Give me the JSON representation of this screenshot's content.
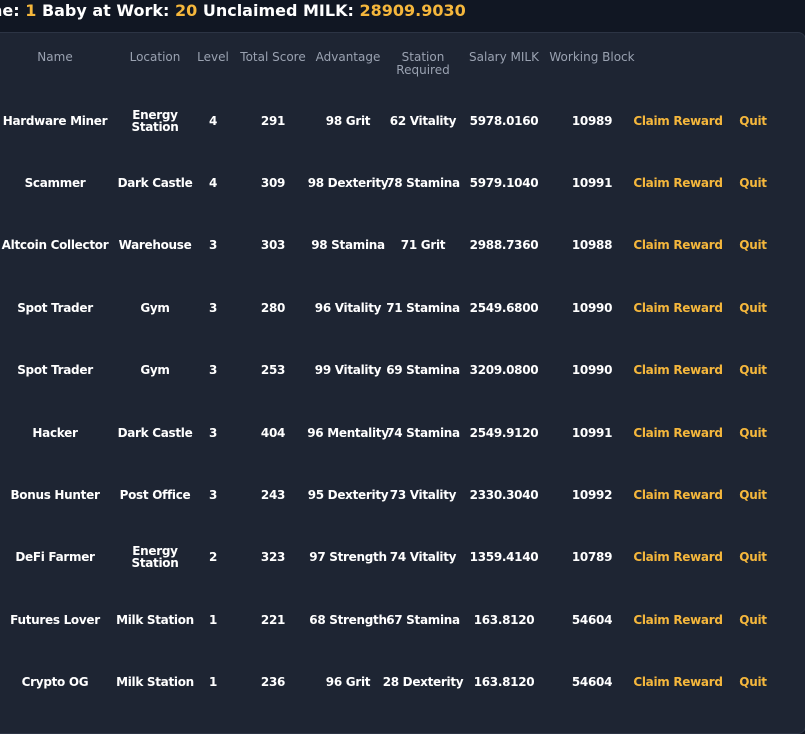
{
  "topbar": {
    "zone_label": "ne:",
    "zone_value": "1",
    "baby_label": "Baby at Work:",
    "baby_value": "20",
    "milk_label": "Unclaimed MILK:",
    "milk_value": "28909.9030"
  },
  "table": {
    "headers": {
      "name": "Name",
      "location": "Location",
      "level": "Level",
      "total_score": "Total Score",
      "advantage": "Advantage",
      "station_required_1": "Station",
      "station_required_2": "Required",
      "salary": "Salary MILK",
      "working_block": "Working Block"
    },
    "action_claim": "Claim Reward",
    "action_quit": "Quit",
    "rows": [
      {
        "name": "Hardware Miner",
        "location": "Energy Station",
        "level": "4",
        "score": "291",
        "advantage": "98 Grit",
        "station": "62 Vitality",
        "salary": "5978.0160",
        "block": "10989"
      },
      {
        "name": "Scammer",
        "location": "Dark Castle",
        "level": "4",
        "score": "309",
        "advantage": "98 Dexterity",
        "station": "78 Stamina",
        "salary": "5979.1040",
        "block": "10991"
      },
      {
        "name": "Altcoin Collector",
        "location": "Warehouse",
        "level": "3",
        "score": "303",
        "advantage": "98 Stamina",
        "station": "71 Grit",
        "salary": "2988.7360",
        "block": "10988"
      },
      {
        "name": "Spot Trader",
        "location": "Gym",
        "level": "3",
        "score": "280",
        "advantage": "96 Vitality",
        "station": "71 Stamina",
        "salary": "2549.6800",
        "block": "10990"
      },
      {
        "name": "Spot Trader",
        "location": "Gym",
        "level": "3",
        "score": "253",
        "advantage": "99 Vitality",
        "station": "69 Stamina",
        "salary": "3209.0800",
        "block": "10990"
      },
      {
        "name": "Hacker",
        "location": "Dark Castle",
        "level": "3",
        "score": "404",
        "advantage": "96 Mentality",
        "station": "74 Stamina",
        "salary": "2549.9120",
        "block": "10991"
      },
      {
        "name": "Bonus Hunter",
        "location": "Post Office",
        "level": "3",
        "score": "243",
        "advantage": "95 Dexterity",
        "station": "73 Vitality",
        "salary": "2330.3040",
        "block": "10992"
      },
      {
        "name": "DeFi Farmer",
        "location": "Energy Station",
        "level": "2",
        "score": "323",
        "advantage": "97 Strength",
        "station": "74 Vitality",
        "salary": "1359.4140",
        "block": "10789"
      },
      {
        "name": "Futures Lover",
        "location": "Milk Station",
        "level": "1",
        "score": "221",
        "advantage": "68 Strength",
        "station": "67 Stamina",
        "salary": "163.8120",
        "block": "54604"
      },
      {
        "name": "Crypto OG",
        "location": "Milk Station",
        "level": "1",
        "score": "236",
        "advantage": "96 Grit",
        "station": "28 Dexterity",
        "salary": "163.8120",
        "block": "54604"
      }
    ]
  }
}
